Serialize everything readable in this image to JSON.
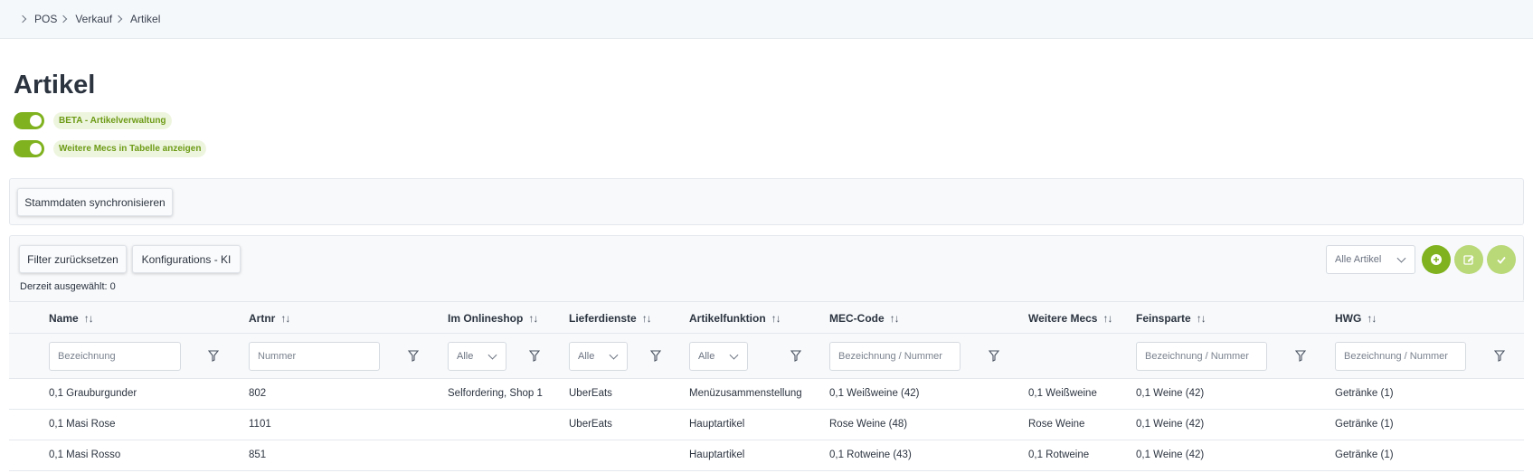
{
  "breadcrumb": [
    "POS",
    "Verkauf",
    "Artikel"
  ],
  "page_title": "Artikel",
  "toggles": [
    {
      "label": "BETA - Artikelverwaltung",
      "on": true
    },
    {
      "label": "Weitere Mecs in Tabelle anzeigen",
      "on": true
    }
  ],
  "sync_button": "Stammdaten synchronisieren",
  "toolbar": {
    "reset_filter": "Filter zurücksetzen",
    "config_ki": "Konfigurations - KI",
    "selected_text": "Derzeit ausgewählt: 0",
    "article_select": "Alle Artikel"
  },
  "colors": {
    "accent": "#7fb21e",
    "accent_light": "#b9d877"
  },
  "columns": [
    "Name",
    "Artnr",
    "Im Onlineshop",
    "Lieferdienste",
    "Artikelfunktion",
    "MEC-Code",
    "Weitere Mecs",
    "Feinsparte",
    "HWG"
  ],
  "filters": {
    "name": "Bezeichnung",
    "artnr": "Nummer",
    "onlineshop": "Alle",
    "lieferdienste": "Alle",
    "artikelfunktion": "Alle",
    "mec": "Bezeichnung / Nummer",
    "feinsparte": "Bezeichnung / Nummer",
    "hwg": "Bezeichnung / Nummer"
  },
  "rows": [
    [
      "0,1 Grauburgunder",
      "802",
      "Selfordering, Shop 1",
      "UberEats",
      "Menüzusammenstellung",
      "0,1 Weißweine (42)",
      "0,1 Weißweine",
      "0,1 Weine (42)",
      "Getränke (1)"
    ],
    [
      "0,1 Masi Rose",
      "1101",
      "",
      "UberEats",
      "Hauptartikel",
      "Rose Weine (48)",
      "Rose Weine",
      "0,1 Weine (42)",
      "Getränke (1)"
    ],
    [
      "0,1 Masi Rosso",
      "851",
      "",
      "",
      "Hauptartikel",
      "0,1 Rotweine (43)",
      "0,1 Rotweine",
      "0,1 Weine (42)",
      "Getränke (1)"
    ]
  ]
}
